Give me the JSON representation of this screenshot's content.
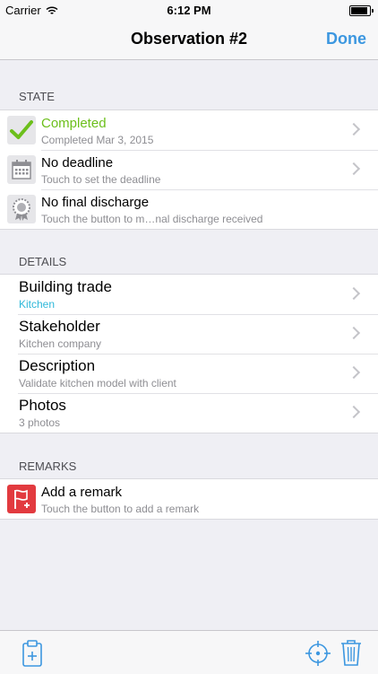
{
  "status_bar": {
    "carrier": "Carrier",
    "time": "6:12 PM",
    "battery_level": 1.0
  },
  "nav": {
    "title": "Observation #2",
    "done_label": "Done"
  },
  "sections": {
    "state_header": "STATE",
    "details_header": "DETAILS",
    "remarks_header": "REMARKS"
  },
  "state": {
    "completed_title": "Completed",
    "completed_sub": "Completed Mar 3, 2015",
    "deadline_title": "No deadline",
    "deadline_sub": "Touch to set the deadline",
    "discharge_title": "No final discharge",
    "discharge_sub": "Touch the button to m…nal discharge received"
  },
  "details": {
    "building_trade_title": "Building trade",
    "building_trade_value": "Kitchen",
    "stakeholder_title": "Stakeholder",
    "stakeholder_value": "Kitchen company",
    "description_title": "Description",
    "description_value": "Validate kitchen model with client",
    "photos_title": "Photos",
    "photos_value": "3 photos"
  },
  "remarks": {
    "add_title": "Add a remark",
    "add_sub": "Touch the button to add a remark"
  },
  "colors": {
    "accent_blue": "#3c97e0",
    "completed_green": "#6cbf1b",
    "trade_cyan": "#2eb8d9",
    "remark_red": "#e23a3f"
  },
  "icons": {
    "wifi": "wifi-icon",
    "completed": "checkmark-icon",
    "deadline": "calendar-icon",
    "discharge": "rosette-icon",
    "remark": "flag-plus-icon",
    "clipboard": "clipboard-add-icon",
    "locate": "crosshair-icon",
    "delete": "trash-icon"
  }
}
